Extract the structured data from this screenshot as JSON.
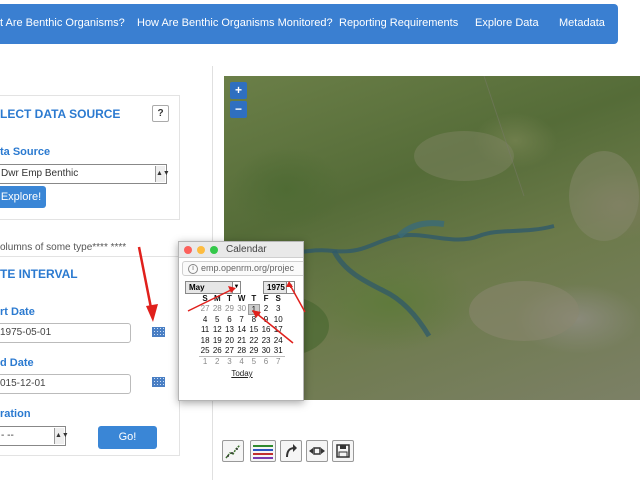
{
  "nav": {
    "items": [
      "t Are Benthic Organisms?",
      "How Are Benthic Organisms Monitored?",
      "Reporting Requirements",
      "Explore Data",
      "Metadata"
    ]
  },
  "select_source": {
    "title": "LECT DATA SOURCE",
    "help_label": "?",
    "data_source_label": "ta Source",
    "data_source_value": "Dwr Emp Benthic",
    "explore_button": "Explore!"
  },
  "note_text": "olumns of some type**** ****",
  "date_interval": {
    "title": "TE INTERVAL",
    "start_label": "rt Date",
    "start_value": "1975-05-01",
    "end_label": "d Date",
    "end_value": "015-12-01",
    "duration_label": "ration",
    "duration_value": "- --",
    "go_button": "Go!"
  },
  "map": {
    "zoom_in": "+",
    "zoom_out": "−"
  },
  "toolbar": {
    "icons": [
      "scatter-plot-icon",
      "line-series-icon",
      "redo-arrow-icon",
      "expand-width-icon",
      "save-icon"
    ]
  },
  "calendar": {
    "window_title": "Calendar",
    "url": "emp.openrm.org/projec",
    "url_host": "emp.openrm.org",
    "month": "May",
    "year": "1975",
    "weekdays": [
      "S",
      "M",
      "T",
      "W",
      "T",
      "F",
      "S"
    ],
    "weeks": [
      [
        "27",
        "28",
        "29",
        "30",
        "1",
        "2",
        "3"
      ],
      [
        "4",
        "5",
        "6",
        "7",
        "8",
        "9",
        "10"
      ],
      [
        "11",
        "12",
        "13",
        "14",
        "15",
        "16",
        "17"
      ],
      [
        "18",
        "19",
        "20",
        "21",
        "22",
        "23",
        "24"
      ],
      [
        "25",
        "26",
        "27",
        "28",
        "29",
        "30",
        "31"
      ],
      [
        "1",
        "2",
        "3",
        "4",
        "5",
        "6",
        "7"
      ]
    ],
    "selected": "1",
    "today_link": "Today"
  },
  "colors": {
    "nav_bg": "#3a7fd1",
    "heading_blue": "#2b7ad0",
    "arrow_red": "#e0201c"
  }
}
